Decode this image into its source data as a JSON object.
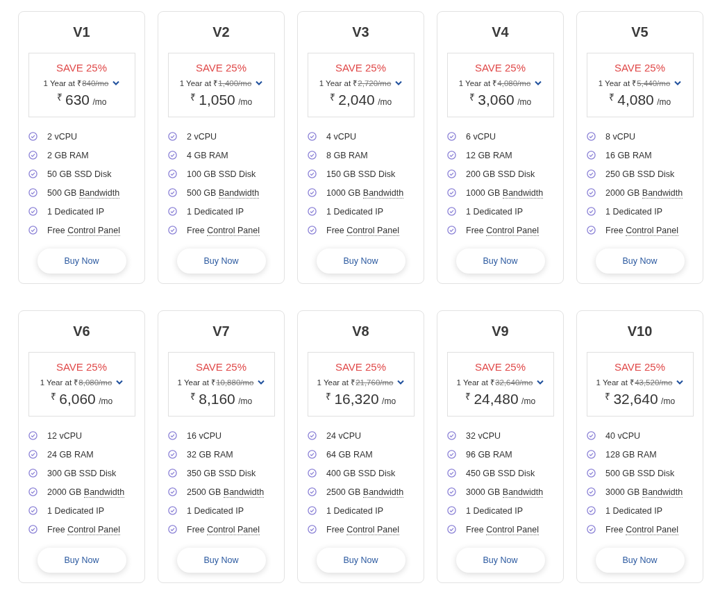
{
  "plans": [
    {
      "name": "V1",
      "save": "SAVE 25%",
      "term": "1 Year at",
      "old_currency": "₹",
      "old_price": "840/mo",
      "currency": "₹",
      "price": "630",
      "per": "/mo",
      "features": [
        {
          "text": "2 vCPU"
        },
        {
          "text": "2 GB RAM"
        },
        {
          "text": "50 GB SSD Disk"
        },
        {
          "text": "500 GB",
          "term": "Bandwidth"
        },
        {
          "text": "1 Dedicated IP"
        },
        {
          "text": "Free",
          "term": "Control Panel"
        }
      ],
      "button": "Buy Now"
    },
    {
      "name": "V2",
      "save": "SAVE 25%",
      "term": "1 Year at",
      "old_currency": "₹",
      "old_price": "1,400/mo",
      "currency": "₹",
      "price": "1,050",
      "per": "/mo",
      "features": [
        {
          "text": "2 vCPU"
        },
        {
          "text": "4 GB RAM"
        },
        {
          "text": "100 GB SSD Disk"
        },
        {
          "text": "500 GB",
          "term": "Bandwidth"
        },
        {
          "text": "1 Dedicated IP"
        },
        {
          "text": "Free",
          "term": "Control Panel"
        }
      ],
      "button": "Buy Now"
    },
    {
      "name": "V3",
      "save": "SAVE 25%",
      "term": "1 Year at",
      "old_currency": "₹",
      "old_price": "2,720/mo",
      "currency": "₹",
      "price": "2,040",
      "per": "/mo",
      "features": [
        {
          "text": "4 vCPU"
        },
        {
          "text": "8 GB RAM"
        },
        {
          "text": "150 GB SSD Disk"
        },
        {
          "text": "1000 GB",
          "term": "Bandwidth"
        },
        {
          "text": "1 Dedicated IP"
        },
        {
          "text": "Free",
          "term": "Control Panel"
        }
      ],
      "button": "Buy Now"
    },
    {
      "name": "V4",
      "save": "SAVE 25%",
      "term": "1 Year at",
      "old_currency": "₹",
      "old_price": "4,080/mo",
      "currency": "₹",
      "price": "3,060",
      "per": "/mo",
      "features": [
        {
          "text": "6 vCPU"
        },
        {
          "text": "12 GB RAM"
        },
        {
          "text": "200 GB SSD Disk"
        },
        {
          "text": "1000 GB",
          "term": "Bandwidth"
        },
        {
          "text": "1 Dedicated IP"
        },
        {
          "text": "Free",
          "term": "Control Panel"
        }
      ],
      "button": "Buy Now"
    },
    {
      "name": "V5",
      "save": "SAVE 25%",
      "term": "1 Year at",
      "old_currency": "₹",
      "old_price": "5,440/mo",
      "currency": "₹",
      "price": "4,080",
      "per": "/mo",
      "features": [
        {
          "text": "8 vCPU"
        },
        {
          "text": "16 GB RAM"
        },
        {
          "text": "250 GB SSD Disk"
        },
        {
          "text": "2000 GB",
          "term": "Bandwidth"
        },
        {
          "text": "1 Dedicated IP"
        },
        {
          "text": "Free",
          "term": "Control Panel"
        }
      ],
      "button": "Buy Now"
    },
    {
      "name": "V6",
      "save": "SAVE 25%",
      "term": "1 Year at",
      "old_currency": "₹",
      "old_price": "8,080/mo",
      "currency": "₹",
      "price": "6,060",
      "per": "/mo",
      "features": [
        {
          "text": "12 vCPU"
        },
        {
          "text": "24 GB RAM"
        },
        {
          "text": "300 GB SSD Disk"
        },
        {
          "text": "2000 GB",
          "term": "Bandwidth"
        },
        {
          "text": "1 Dedicated IP"
        },
        {
          "text": "Free",
          "term": "Control Panel"
        }
      ],
      "button": "Buy Now"
    },
    {
      "name": "V7",
      "save": "SAVE 25%",
      "term": "1 Year at",
      "old_currency": "₹",
      "old_price": "10,880/mo",
      "currency": "₹",
      "price": "8,160",
      "per": "/mo",
      "features": [
        {
          "text": "16 vCPU"
        },
        {
          "text": "32 GB RAM"
        },
        {
          "text": "350 GB SSD Disk"
        },
        {
          "text": "2500 GB",
          "term": "Bandwidth"
        },
        {
          "text": "1 Dedicated IP"
        },
        {
          "text": "Free",
          "term": "Control Panel"
        }
      ],
      "button": "Buy Now"
    },
    {
      "name": "V8",
      "save": "SAVE 25%",
      "term": "1 Year at",
      "old_currency": "₹",
      "old_price": "21,760/mo",
      "currency": "₹",
      "price": "16,320",
      "per": "/mo",
      "features": [
        {
          "text": "24 vCPU"
        },
        {
          "text": "64 GB RAM"
        },
        {
          "text": "400 GB SSD Disk"
        },
        {
          "text": "2500 GB",
          "term": "Bandwidth"
        },
        {
          "text": "1 Dedicated IP"
        },
        {
          "text": "Free",
          "term": "Control Panel"
        }
      ],
      "button": "Buy Now"
    },
    {
      "name": "V9",
      "save": "SAVE 25%",
      "term": "1 Year at",
      "old_currency": "₹",
      "old_price": "32,640/mo",
      "currency": "₹",
      "price": "24,480",
      "per": "/mo",
      "features": [
        {
          "text": "32 vCPU"
        },
        {
          "text": "96 GB RAM"
        },
        {
          "text": "450 GB SSD Disk"
        },
        {
          "text": "3000 GB",
          "term": "Bandwidth"
        },
        {
          "text": "1 Dedicated IP"
        },
        {
          "text": "Free",
          "term": "Control Panel"
        }
      ],
      "button": "Buy Now"
    },
    {
      "name": "V10",
      "save": "SAVE 25%",
      "term": "1 Year at",
      "old_currency": "₹",
      "old_price": "43,520/mo",
      "currency": "₹",
      "price": "32,640",
      "per": "/mo",
      "features": [
        {
          "text": "40 vCPU"
        },
        {
          "text": "128 GB RAM"
        },
        {
          "text": "500 GB SSD Disk"
        },
        {
          "text": "3000 GB",
          "term": "Bandwidth"
        },
        {
          "text": "1 Dedicated IP"
        },
        {
          "text": "Free",
          "term": "Control Panel"
        }
      ],
      "button": "Buy Now"
    }
  ]
}
